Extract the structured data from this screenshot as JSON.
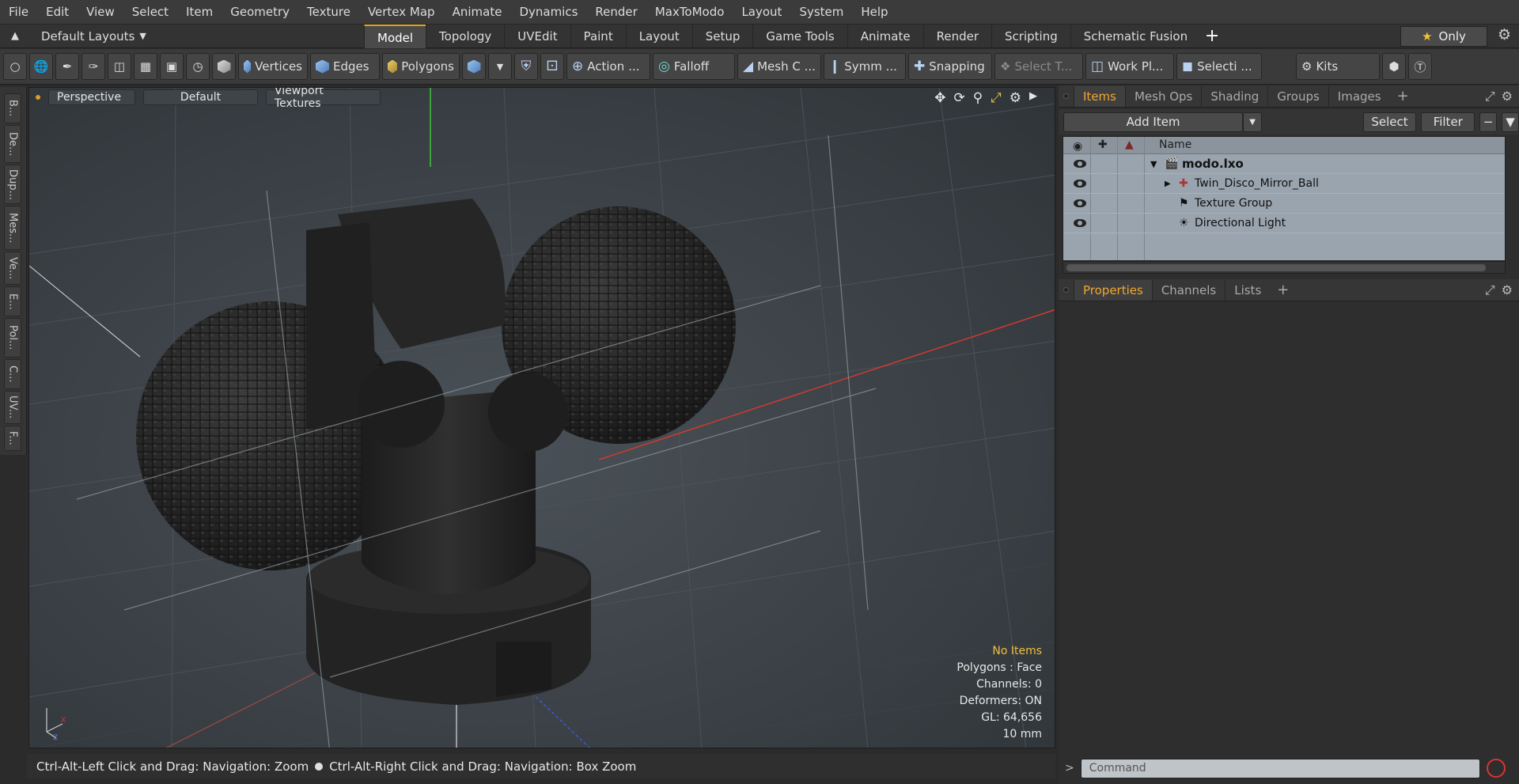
{
  "menu": [
    "File",
    "Edit",
    "View",
    "Select",
    "Item",
    "Geometry",
    "Texture",
    "Vertex Map",
    "Animate",
    "Dynamics",
    "Render",
    "MaxToModo",
    "Layout",
    "System",
    "Help"
  ],
  "layoutbar": {
    "layout_name": "Default Layouts",
    "tabs": [
      "Model",
      "Topology",
      "UVEdit",
      "Paint",
      "Layout",
      "Setup",
      "Game Tools",
      "Animate",
      "Render",
      "Scripting",
      "Schematic Fusion"
    ],
    "active_tab": "Model",
    "only_label": "Only"
  },
  "toolbar": {
    "vertices": "Vertices",
    "edges": "Edges",
    "polygons": "Polygons",
    "action": "Action",
    "action_more": "...",
    "falloff": "Falloff",
    "mesh": "Mesh C ...",
    "symm": "Symm ...",
    "snapping": "Snapping",
    "select_t": "Select T...",
    "work_plane": "Work Pl...",
    "selection": "Selecti ...",
    "kits": "Kits"
  },
  "left_tabs": [
    "B...",
    "De...",
    "Dup...",
    "Mes...",
    "Ve...",
    "E...",
    "Pol...",
    "C...",
    "UV...",
    "F..."
  ],
  "viewport": {
    "view_mode": "Perspective",
    "shading": "Default",
    "texture_mode": "Viewport Textures",
    "info": {
      "items": "No Items",
      "polygons": "Polygons : Face",
      "channels": "Channels: 0",
      "deformers": "Deformers: ON",
      "gl": "GL: 64,656",
      "scale": "10 mm"
    }
  },
  "statusbar": {
    "hint_left": "Ctrl-Alt-Left Click and Drag: Navigation: Zoom",
    "hint_right": "Ctrl-Alt-Right Click and Drag: Navigation: Box Zoom"
  },
  "items_panel": {
    "tabs": [
      "Items",
      "Mesh Ops",
      "Shading",
      "Groups",
      "Images"
    ],
    "active_tab": "Items",
    "add_item": "Add Item",
    "select": "Select",
    "filter": "Filter",
    "column_name": "Name",
    "tree": [
      {
        "label": "modo.lxo",
        "icon": "clapper-icon",
        "indent": 0,
        "bold": true
      },
      {
        "label": "Twin_Disco_Mirror_Ball",
        "icon": "locator-icon",
        "indent": 1,
        "bold": false
      },
      {
        "label": "Texture Group",
        "icon": "folder-icon",
        "indent": 1,
        "bold": false
      },
      {
        "label": "Directional Light",
        "icon": "light-icon",
        "indent": 1,
        "bold": false
      }
    ]
  },
  "properties_panel": {
    "tabs": [
      "Properties",
      "Channels",
      "Lists"
    ],
    "active_tab": "Properties"
  },
  "command": {
    "placeholder": "Command"
  },
  "colors": {
    "accent": "#e3a417",
    "tree_bg": "#9aa4ae",
    "x_axis": "#d23a2e",
    "y_axis": "#3ec43a",
    "z_axis": "#3a5ad0"
  }
}
